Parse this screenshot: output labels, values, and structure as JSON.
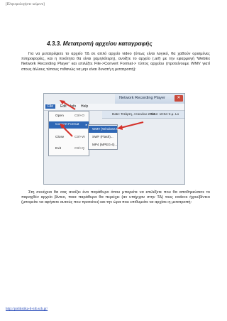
{
  "header": {
    "note": "[Πληκτρολογήστε κείμενο]"
  },
  "section": {
    "title": "4.3.3. Μετατροπή αρχείου καταγραφής"
  },
  "paragraphs": {
    "first": "Για να μετατρέψετε το αρχείο ΤΔ σε απλό αρχείο video (όπως είναι λογικό, θα χαθούν ορισμένες πληροφορίες, και η ποιότητα θα είναι χαμηλότερη), ανοίξτε το αρχείο (.arf) με την εφαρμογή 'WebEx Network Recording Player' και επιλέξτε File->Convert Format-> τύπος αρχείου (προτείνουμε WMV γιατί στους άλλους τύπους πιθανώς να μην είναι δυνατή η μετατροπή):",
    "second": "Στη συνέχεια θα σας ανοίξει ένα παράθυρο όπου μπορείτε να επιλέξετε που θα αποθηκεύσετε το παραχθέν αρχείο βίντεο, ποια παράθυρα θα περιέχει (αν υπήρχαν στην ΤΔ) τους codecs ήχου/βίντεο (μπορείτε να αφήσετε αυτούς που προτείνει) και την ώρα που επιθυμείτε να αρχίσει η μετατροπή:"
  },
  "screenshot": {
    "window_title": "Network Recording Player",
    "close_symbol": "✕",
    "menu": [
      "File",
      "Edit",
      "Info",
      "Help"
    ],
    "file_menu": [
      {
        "label": "Open",
        "shortcut": "Ctrl+O"
      },
      {
        "label": "Convert Format",
        "shortcut": "▸"
      },
      {
        "label": "Close",
        "shortcut": "Ctrl+W"
      },
      {
        "label": "Exit",
        "shortcut": "Ctrl+Q"
      }
    ],
    "submenu": [
      "WMV (Windows Media...",
      "SWF (Flash)...",
      "MP4 (MPEG-4)..."
    ],
    "info_date": "Date: Τετάρτη, 4 Ιουνίου 2014",
    "info_time": "Time: 10:54 π.μ. Lo"
  },
  "footer": {
    "link": "http://politistika-il-nib.sch.gr/"
  },
  "colors": {
    "accent": "#2f67b5",
    "arrow": "#d4312a"
  }
}
